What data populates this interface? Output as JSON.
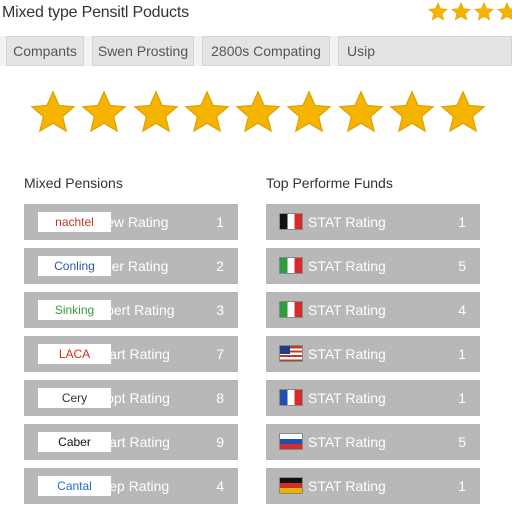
{
  "header": {
    "title": "Mixed type Pensitl Poducts",
    "rating_stars": 4,
    "star_color": "#f5b400"
  },
  "tabs": [
    {
      "label": "Compants"
    },
    {
      "label": "Swen Prosting"
    },
    {
      "label": "2800s Compating"
    },
    {
      "label": "Usip"
    }
  ],
  "rating_banner": {
    "stars": 9,
    "star_color": "#f5b400"
  },
  "left_panel": {
    "title": "Mixed Pensions",
    "rows": [
      {
        "logo": "nachtel",
        "label": "New Rating",
        "value": "1",
        "logo_color": "#c0392b"
      },
      {
        "logo": "Conling",
        "label": "Inter Rating",
        "value": "2",
        "logo_color": "#2c5aa0"
      },
      {
        "logo": "Sinking",
        "label": "Upert Rating",
        "value": "3",
        "logo_color": "#3a9d3a"
      },
      {
        "logo": "LACA",
        "label": "Start Rating",
        "value": "7",
        "logo_color": "#d12a1e"
      },
      {
        "logo": "Cery",
        "label": "Copt Rating",
        "value": "8",
        "logo_color": "#333333"
      },
      {
        "logo": "Caber",
        "label": "Start Rating",
        "value": "9",
        "logo_color": "#111111"
      },
      {
        "logo": "Cantal",
        "label": "Step Rating",
        "value": "4",
        "logo_color": "#1a73c9"
      }
    ]
  },
  "right_panel": {
    "title": "Top Performe Funds",
    "rows": [
      {
        "flag": "belgium-flag-icon",
        "label": "STAT Rating",
        "value": "1"
      },
      {
        "flag": "italy-flag-icon",
        "label": "STAT Rating",
        "value": "5"
      },
      {
        "flag": "italy-flag-icon",
        "label": "STAT Rating",
        "value": "4"
      },
      {
        "flag": "usa-flag-icon",
        "label": "STAT Rating",
        "value": "1"
      },
      {
        "flag": "france-flag-icon",
        "label": "STAT Rating",
        "value": "1"
      },
      {
        "flag": "slovakia-flag-icon",
        "label": "STAT Rating",
        "value": "5"
      },
      {
        "flag": "germany-flag-icon",
        "label": "STAT Rating",
        "value": "1"
      }
    ]
  }
}
